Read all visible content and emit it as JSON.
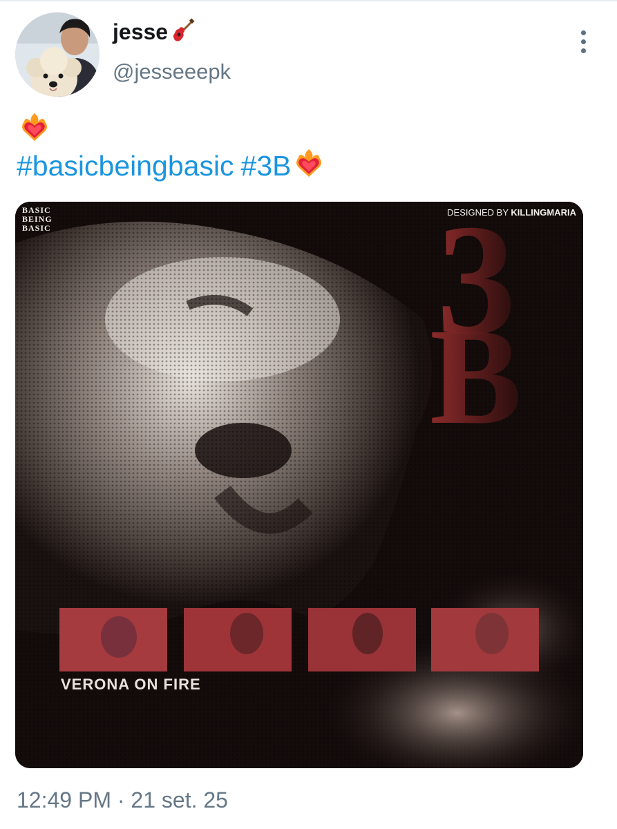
{
  "author": {
    "display_name": "jesse",
    "display_emoji": "guitar-emoji",
    "handle": "@jesseeepk"
  },
  "tweet": {
    "lead_emoji": "heart-on-fire-emoji",
    "hashtags": [
      "#basicbeingbasic",
      "#3B"
    ],
    "trailing_emoji": "heart-on-fire-emoji"
  },
  "poster": {
    "brand_lines": [
      "BASIC",
      "BEING",
      "BASIC"
    ],
    "designer_label": "DESIGNED BY",
    "designer_name": "KILLINGMARIA",
    "big_letters": [
      "3",
      "B"
    ],
    "subtitle": "VERONA ON FIRE"
  },
  "meta": {
    "time": "12:49 PM",
    "separator": "·",
    "date": "21 set. 25"
  },
  "colors": {
    "link": "#1b95e0",
    "accent_red": "#8a2a2a",
    "text_primary": "#14171a",
    "text_secondary": "#657786"
  }
}
